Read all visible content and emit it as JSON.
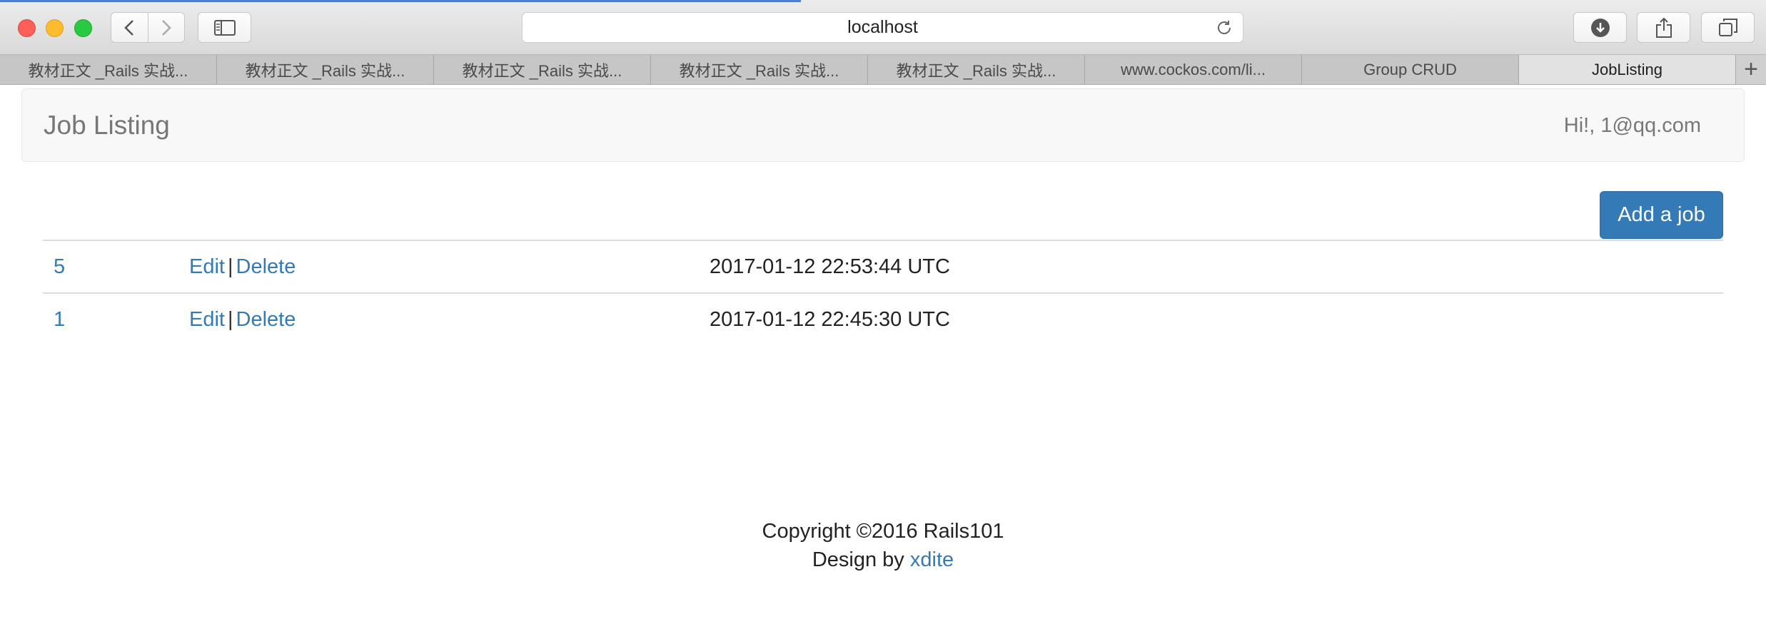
{
  "browser": {
    "address": "localhost",
    "tabs": [
      {
        "label": "教材正文 _Rails 实战..."
      },
      {
        "label": "教材正文 _Rails 实战..."
      },
      {
        "label": "教材正文 _Rails 实战..."
      },
      {
        "label": "教材正文 _Rails 实战..."
      },
      {
        "label": "教材正文 _Rails 实战..."
      },
      {
        "label": "www.cockos.com/li..."
      },
      {
        "label": "Group CRUD"
      },
      {
        "label": "JobListing"
      }
    ],
    "new_tab_label": "+"
  },
  "navbar": {
    "brand": "Job Listing",
    "greeting": "Hi!, 1@qq.com"
  },
  "actions": {
    "add_job": "Add a job"
  },
  "jobs": [
    {
      "id": "5",
      "edit": "Edit",
      "sep": "|",
      "delete": "Delete",
      "created_at": "2017-01-12 22:53:44 UTC"
    },
    {
      "id": "1",
      "edit": "Edit",
      "sep": "|",
      "delete": "Delete",
      "created_at": "2017-01-12 22:45:30 UTC"
    }
  ],
  "footer": {
    "copyright": "Copyright ©2016 Rails101",
    "design_by": "Design by",
    "designer": "xdite"
  },
  "colors": {
    "link": "#337ab7",
    "button_bg": "#337ab7",
    "navbar_bg": "#f8f8f8"
  }
}
